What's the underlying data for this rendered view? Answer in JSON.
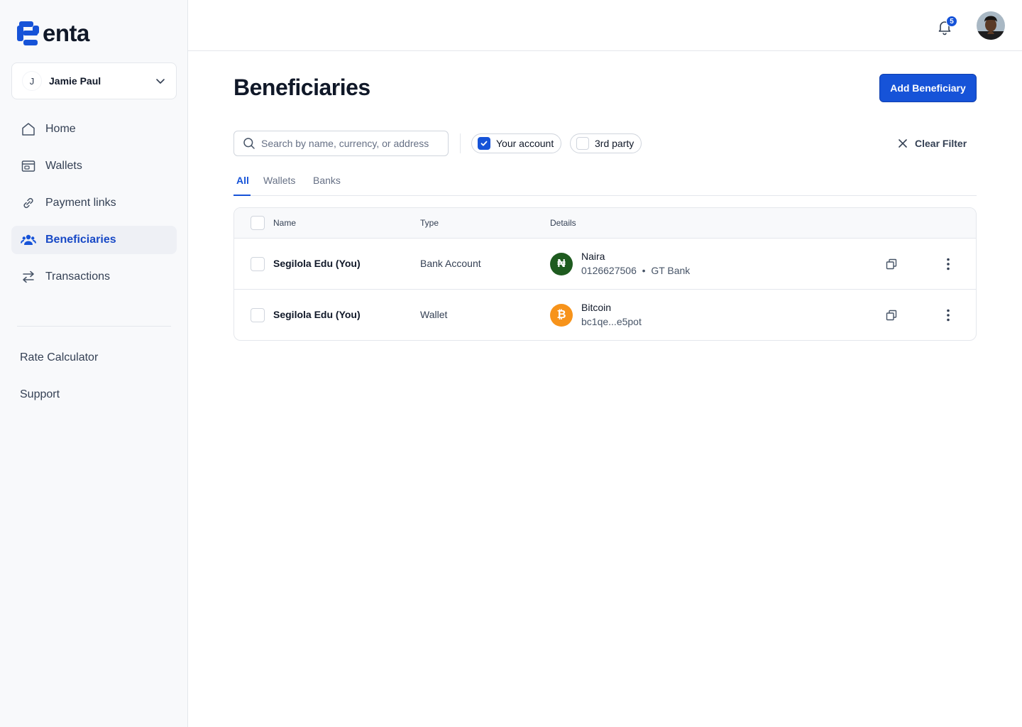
{
  "brand": {
    "name": "enta",
    "accent": "#1653d8"
  },
  "account": {
    "initial": "J",
    "name": "Jamie Paul"
  },
  "nav": [
    {
      "label": "Home",
      "icon": "home-icon",
      "active": false
    },
    {
      "label": "Wallets",
      "icon": "wallet-icon",
      "active": false
    },
    {
      "label": "Payment links",
      "icon": "link-icon",
      "active": false
    },
    {
      "label": "Beneficiaries",
      "icon": "users-icon",
      "active": true
    },
    {
      "label": "Transactions",
      "icon": "transfer-icon",
      "active": false
    }
  ],
  "sub_nav": [
    "Rate Calculator",
    "Support"
  ],
  "topbar": {
    "notification_count": "5"
  },
  "page": {
    "title": "Beneficiaries",
    "add_button": "Add Beneficiary"
  },
  "filters": {
    "search_placeholder": "Search by name, currency, or address",
    "your_account": {
      "label": "Your account",
      "checked": true
    },
    "third_party": {
      "label": "3rd party",
      "checked": false
    },
    "clear": "Clear Filter"
  },
  "tabs": [
    {
      "label": "All",
      "active": true
    },
    {
      "label": "Wallets",
      "active": false
    },
    {
      "label": "Banks",
      "active": false
    }
  ],
  "table": {
    "headers": {
      "name": "Name",
      "type": "Type",
      "details": "Details"
    },
    "rows": [
      {
        "name": "Segilola Edu (You)",
        "type": "Bank Account",
        "currency": "Naira",
        "symbol": "₦",
        "color": "#1e5b1f",
        "detail": "0126627506  •  GT Bank"
      },
      {
        "name": "Segilola Edu (You)",
        "type": "Wallet",
        "currency": "Bitcoin",
        "symbol": "₿",
        "color": "#f7931a",
        "detail": "bc1qe...e5pot"
      }
    ]
  }
}
